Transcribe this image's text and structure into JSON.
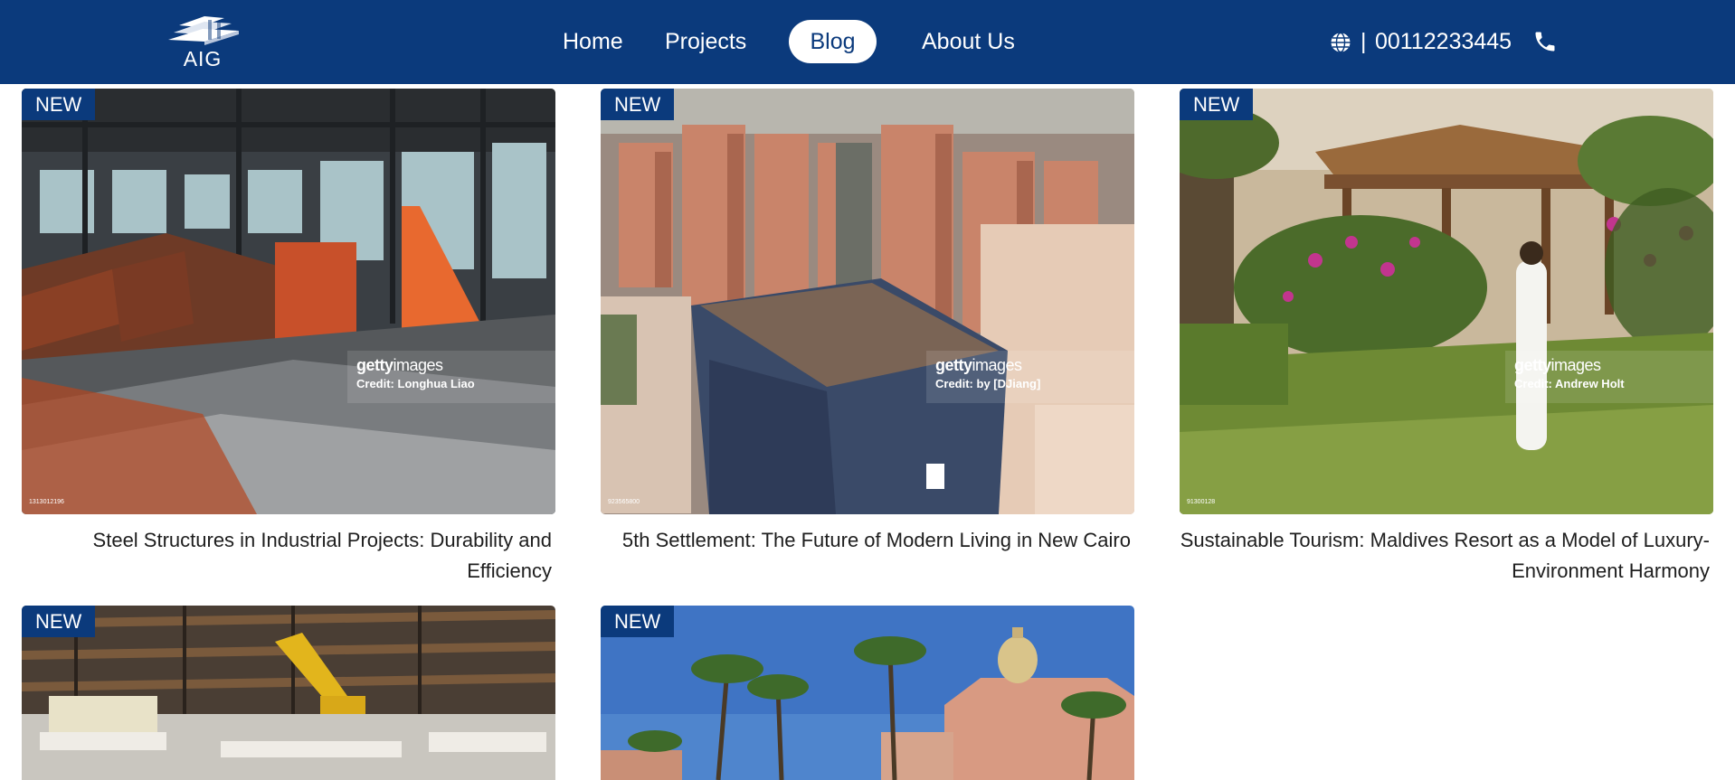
{
  "brand": {
    "logo_text": "AIG",
    "primary_color": "#0b3a7c"
  },
  "nav": {
    "items": [
      {
        "label": "Home"
      },
      {
        "label": "Projects"
      },
      {
        "label": "Blog",
        "active": true
      },
      {
        "label": "About Us"
      }
    ]
  },
  "contact": {
    "icon": "globe-icon",
    "separator": "|",
    "phone": "00112233445",
    "phone_icon": "phone-icon"
  },
  "badge_label": "NEW",
  "watermark_brand": "gettyimages",
  "posts": [
    {
      "title": "Steel Structures in Industrial Projects: Durability and Efficiency",
      "credit": "Credit: Longhua Liao",
      "image_id": "1313012196"
    },
    {
      "title": "5th Settlement: The Future of Modern Living in New Cairo",
      "credit": "Credit: by [DJiang]",
      "image_id": "923565800"
    },
    {
      "title": "Sustainable Tourism: Maldives Resort as a Model of Luxury-Environment Harmony",
      "credit": "Credit: Andrew Holt",
      "image_id": "91300128"
    },
    {
      "title": "",
      "credit": "",
      "image_id": ""
    },
    {
      "title": "",
      "credit": "",
      "image_id": ""
    }
  ]
}
